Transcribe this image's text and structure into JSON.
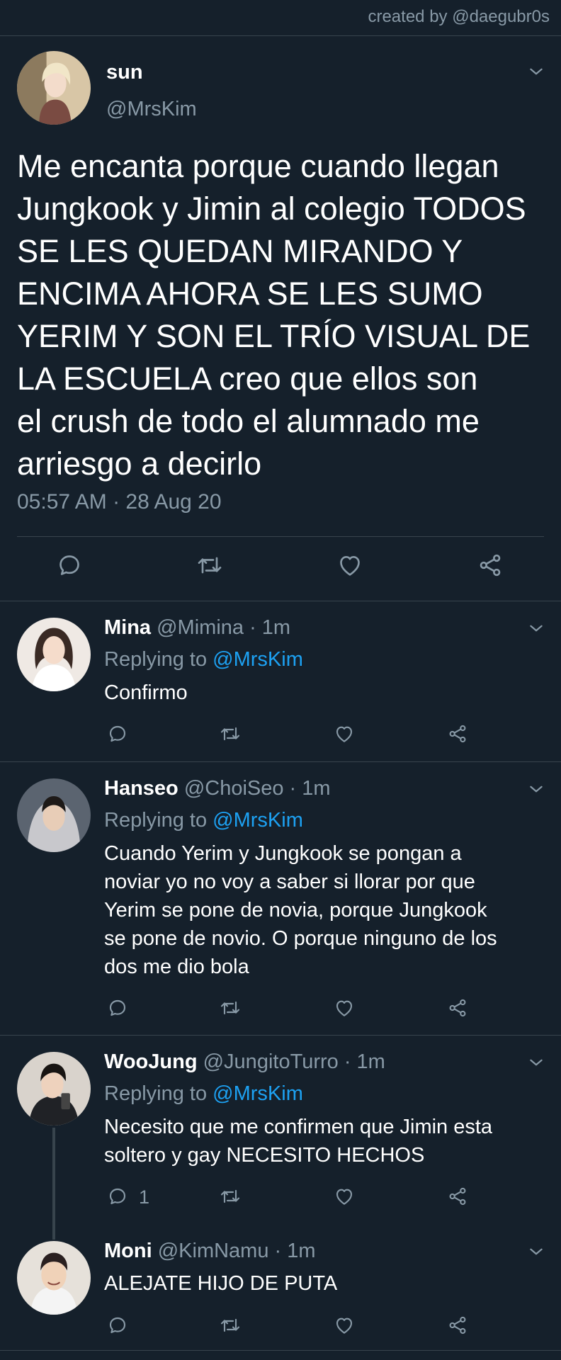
{
  "credit": "created by @daegubr0s",
  "main_tweet": {
    "name": "sun",
    "handle": "@MrsKim",
    "text": "Me encanta porque cuando llegan\nJungkook y Jimin al colegio TODOS\nSE LES QUEDAN MIRANDO Y\nENCIMA AHORA SE LES SUMO\nYERIM Y SON EL TRÍO VISUAL DE\nLA ESCUELA creo que ellos son\nel crush de todo el alumnado me\narriesgo a decirlo",
    "timestamp": "05:57 AM · 28 Aug 20"
  },
  "replies": [
    {
      "name": "Mina",
      "handle_time": " @Mimina · 1m",
      "replying_prefix": "Replying to ",
      "replying_to": "@MrsKim",
      "text": "Confirmo",
      "reply_count": ""
    },
    {
      "name": "Hanseo",
      "handle_time": " @ChoiSeo · 1m",
      "replying_prefix": "Replying to ",
      "replying_to": "@MrsKim",
      "text": "Cuando Yerim y Jungkook se pongan a\nnoviar yo no voy a saber si llorar por que\nYerim se pone de novia, porque Jungkook\nse pone de novio. O porque ninguno de los\ndos me dio bola",
      "reply_count": ""
    },
    {
      "name": "WooJung",
      "handle_time": " @JungitoTurro · 1m",
      "replying_prefix": "Replying to ",
      "replying_to": "@MrsKim",
      "text": "Necesito que me confirmen que Jimin esta\nsoltero y gay NECESITO HECHOS",
      "reply_count": "1"
    },
    {
      "name": "Moni",
      "handle_time": " @KimNamu · 1m",
      "text": "ALEJATE HIJO DE PUTA",
      "reply_count": ""
    }
  ],
  "colors": {
    "background": "#15202b",
    "secondary_text": "#8899a6",
    "link": "#1da1f2",
    "divider": "#38444d"
  },
  "icons": [
    "reply-icon",
    "retweet-icon",
    "like-icon",
    "share-icon",
    "chevron-down-icon"
  ]
}
